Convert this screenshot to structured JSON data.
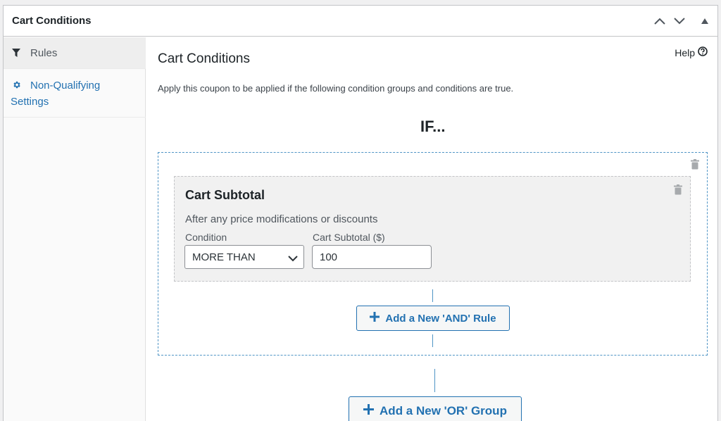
{
  "panel": {
    "title": "Cart Conditions"
  },
  "header_controls": [
    "move-up-icon",
    "move-down-icon",
    "collapse-toggle-icon"
  ],
  "sidebar": {
    "items": [
      {
        "label": "Rules",
        "icon": "filter-icon",
        "active": true
      },
      {
        "label": "Non-Qualifying Settings",
        "icon": "gear-icon",
        "active": false
      }
    ]
  },
  "main": {
    "title": "Cart Conditions",
    "help_label": "Help",
    "description": "Apply this coupon to be applied if the following condition groups and conditions are true.",
    "if_label": "IF..."
  },
  "rule": {
    "title": "Cart Subtotal",
    "description": "After any price modifications or discounts",
    "condition_label": "Condition",
    "condition_value": "MORE THAN",
    "amount_label": "Cart Subtotal ($)",
    "amount_value": "100"
  },
  "buttons": {
    "add_and_rule": "Add a New 'AND' Rule",
    "add_or_group": "Add a New 'OR' Group"
  },
  "colors": {
    "accent": "#2271b1",
    "dashed_border": "#4f94c5",
    "rule_background": "#f1f1f1",
    "sidebar_active": "#eeeeee"
  }
}
